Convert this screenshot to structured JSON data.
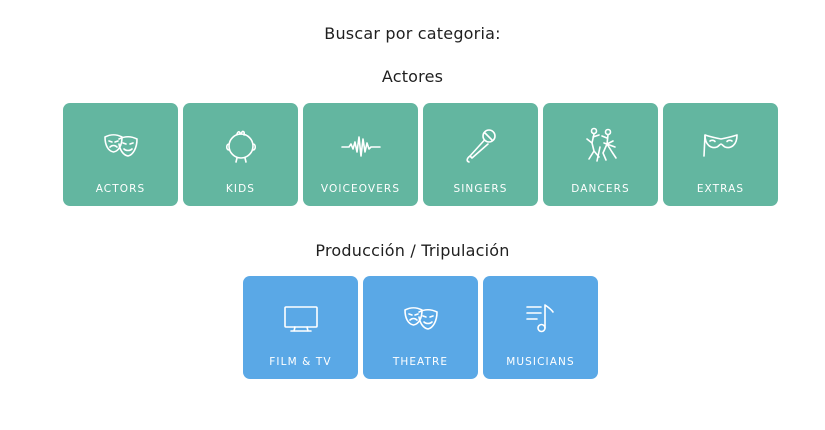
{
  "theme": {
    "actors_color": "#63b6a0",
    "crew_color": "#5aa8e6"
  },
  "title": "Buscar por categoria:",
  "actors_section": {
    "heading": "Actores",
    "items": [
      {
        "label": "ACTORS",
        "icon": "theater-masks-icon"
      },
      {
        "label": "KIDS",
        "icon": "child-face-icon"
      },
      {
        "label": "VOICEOVERS",
        "icon": "sound-wave-icon"
      },
      {
        "label": "SINGERS",
        "icon": "microphone-icon"
      },
      {
        "label": "DANCERS",
        "icon": "dancers-icon"
      },
      {
        "label": "EXTRAS",
        "icon": "masquerade-mask-icon"
      }
    ]
  },
  "crew_section": {
    "heading": "Producción / Tripulación",
    "items": [
      {
        "label": "FILM & TV",
        "icon": "tv-icon"
      },
      {
        "label": "THEATRE",
        "icon": "theater-masks-icon"
      },
      {
        "label": "MUSICIANS",
        "icon": "music-list-icon"
      }
    ]
  }
}
